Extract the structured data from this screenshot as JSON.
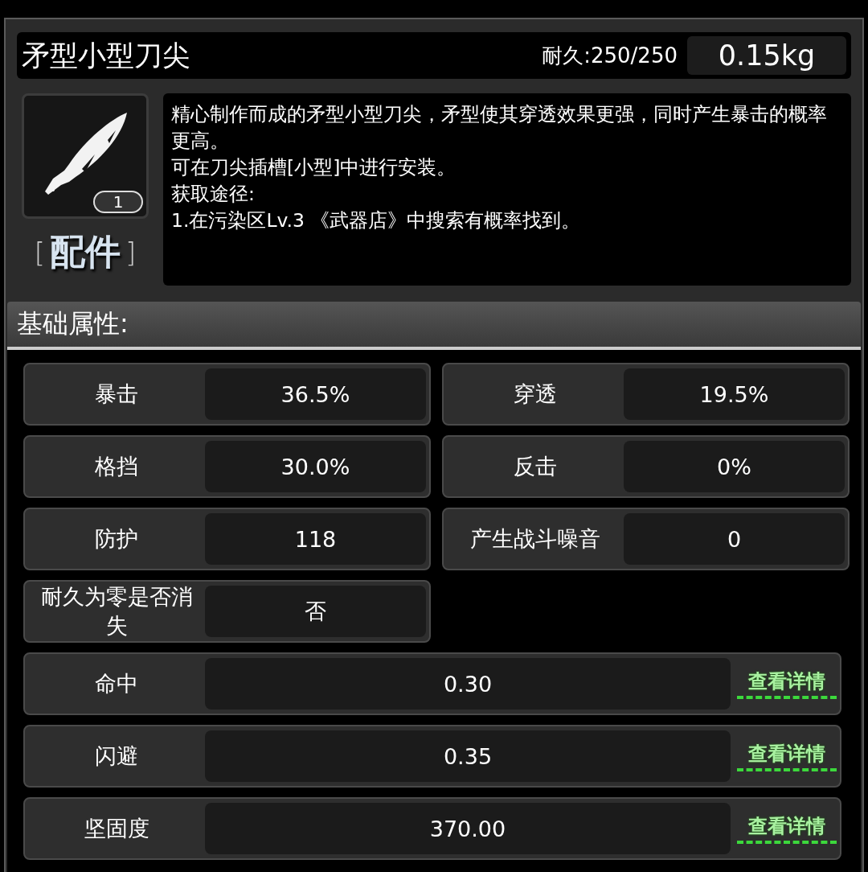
{
  "item": {
    "name": "矛型小型刀尖",
    "durability": "耐久:250/250",
    "weight": "0.15kg",
    "count": "1",
    "category": "配件",
    "brackets": [
      "[",
      "]"
    ]
  },
  "description": [
    "精心制作而成的矛型小型刀尖，矛型使其穿透效果更强，同时产生暴击的概率更高。",
    "可在刀尖插槽[小型]中进行安装。",
    "获取途径:",
    "1.在污染区Lv.3 《武器店》中搜索有概率找到。"
  ],
  "section_title": "基础属性:",
  "stats": [
    {
      "label": "暴击",
      "value": "36.5%"
    },
    {
      "label": "穿透",
      "value": "19.5%"
    },
    {
      "label": "格挡",
      "value": "30.0%"
    },
    {
      "label": "反击",
      "value": "0%"
    },
    {
      "label": "防护",
      "value": "118"
    },
    {
      "label": "产生战斗噪音",
      "value": "0"
    },
    {
      "label": "耐久为零是否消失",
      "value": "否"
    }
  ],
  "detail_stats": [
    {
      "label": "命中",
      "value": "0.30",
      "link": "查看详情"
    },
    {
      "label": "闪避",
      "value": "0.35",
      "link": "查看详情"
    },
    {
      "label": "坚固度",
      "value": "370.00",
      "link": "查看详情"
    }
  ]
}
